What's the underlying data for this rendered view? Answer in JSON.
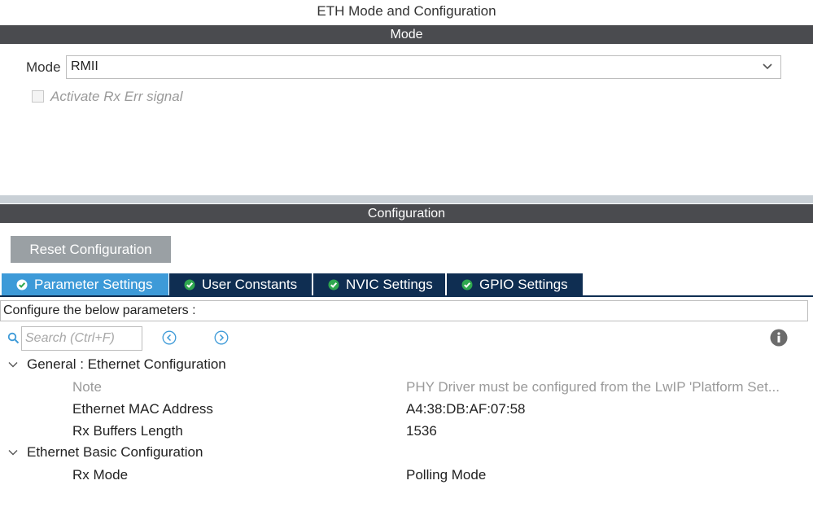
{
  "window": {
    "title": "ETH Mode and Configuration"
  },
  "mode_section": {
    "header": "Mode",
    "mode_label": "Mode",
    "mode_value": "RMII",
    "activate_rx_err": {
      "label": "Activate Rx Err signal",
      "checked": false
    }
  },
  "config_section": {
    "header": "Configuration",
    "reset_label": "Reset Configuration",
    "tabs": [
      {
        "label": "Parameter Settings",
        "active": true
      },
      {
        "label": "User Constants",
        "active": false
      },
      {
        "label": "NVIC Settings",
        "active": false
      },
      {
        "label": "GPIO Settings",
        "active": false
      }
    ],
    "hint": "Configure the below parameters :",
    "search": {
      "placeholder": "Search (Ctrl+F)",
      "value": ""
    },
    "groups": [
      {
        "title": "General : Ethernet Configuration",
        "params": [
          {
            "name": "Note",
            "value": "PHY Driver must be configured from the LwIP 'Platform Set...",
            "muted": true
          },
          {
            "name": "Ethernet MAC Address",
            "value": "A4:38:DB:AF:07:58",
            "muted": false
          },
          {
            "name": "Rx Buffers Length",
            "value": "1536",
            "muted": false
          }
        ]
      },
      {
        "title": "Ethernet Basic Configuration",
        "params": [
          {
            "name": "Rx Mode",
            "value": "Polling Mode",
            "muted": false
          }
        ]
      }
    ]
  },
  "icons": {
    "chevron": "chevron-down-icon",
    "tab_status": "check-circle-icon",
    "search": "search-icon",
    "prev": "previous-icon",
    "next": "next-icon",
    "info": "info-icon"
  },
  "colors": {
    "section_header": "#4a4b4f",
    "tab_active": "#3d9ad8",
    "tab_inactive": "#0f2e52",
    "reset_button": "#9aa0a4",
    "check_green": "#2fa84f"
  }
}
